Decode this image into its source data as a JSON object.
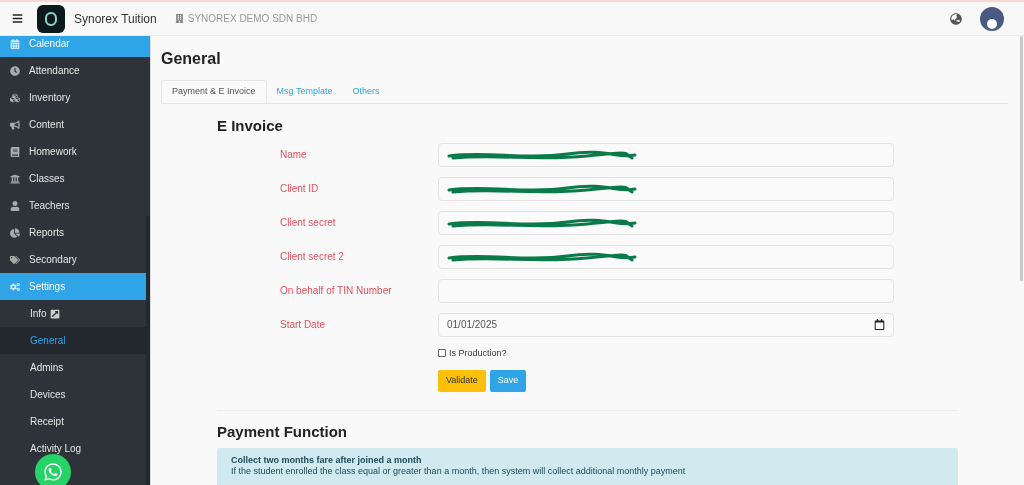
{
  "topbar": {
    "app_name": "Synorex Tuition",
    "company": "SYNOREX DEMO SDN BHD"
  },
  "sidebar": {
    "items": [
      {
        "label": "Calendar",
        "selected": true
      },
      {
        "label": "Attendance",
        "selected": false
      },
      {
        "label": "Inventory",
        "selected": false
      },
      {
        "label": "Content",
        "selected": false
      },
      {
        "label": "Homework",
        "selected": false
      },
      {
        "label": "Classes",
        "selected": false
      },
      {
        "label": "Teachers",
        "selected": false
      },
      {
        "label": "Reports",
        "selected": false
      },
      {
        "label": "Secondary",
        "selected": false
      },
      {
        "label": "Settings",
        "selected": true,
        "children": [
          {
            "label": "Info",
            "selected": false,
            "external": true
          },
          {
            "label": "General",
            "selected": true,
            "external": false
          },
          {
            "label": "Admins",
            "selected": false,
            "external": false
          },
          {
            "label": "Devices",
            "selected": false,
            "external": false
          },
          {
            "label": "Receipt",
            "selected": false,
            "external": false
          },
          {
            "label": "Activity Log",
            "selected": false,
            "external": false
          }
        ]
      }
    ]
  },
  "page": {
    "title": "General",
    "tabs": [
      {
        "label": "Payment & E Invoice",
        "selected": true
      },
      {
        "label": "Msg Template",
        "selected": false
      },
      {
        "label": "Others",
        "selected": false
      }
    ],
    "e_invoice": {
      "heading": "E Invoice",
      "fields": [
        {
          "label": "Name",
          "kind": "text",
          "redacted": true
        },
        {
          "label": "Client ID",
          "kind": "text",
          "redacted": true
        },
        {
          "label": "Client secret",
          "kind": "text",
          "redacted": true
        },
        {
          "label": "Client secret 2",
          "kind": "text",
          "redacted": true
        },
        {
          "label": "On behalf of TIN Number",
          "kind": "text",
          "redacted": false
        },
        {
          "label": "Start Date",
          "kind": "date",
          "redacted": false,
          "value": "01/01/2025"
        }
      ],
      "checkbox": {
        "label": "Is Production?",
        "checked": false
      },
      "buttons": [
        {
          "label": "Validate",
          "kind": "warning"
        },
        {
          "label": "Save",
          "kind": "primary"
        }
      ]
    },
    "payment_function": {
      "heading": "Payment Function",
      "notice": {
        "title": "Collect two months fare after joined a month",
        "text": "If the student enrolled the class equal or greater than a month, then system will collect additional monthly payment"
      }
    }
  }
}
